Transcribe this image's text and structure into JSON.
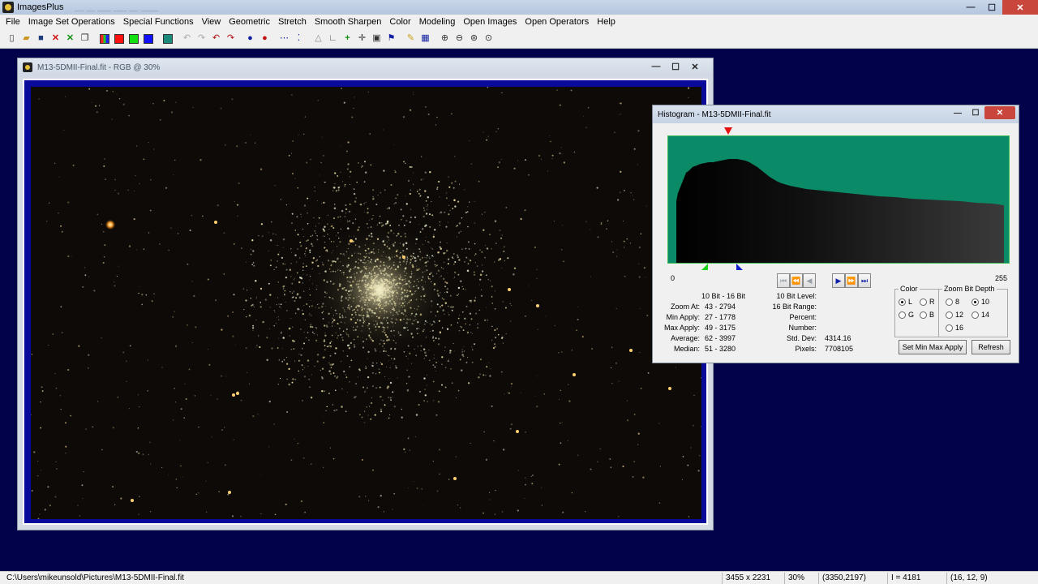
{
  "app": {
    "title": "ImagesPlus",
    "ghost_title": "__ __ ___ ___ __ ____",
    "minimize": "—",
    "maximize": "☐",
    "close": "✕"
  },
  "menu": [
    "File",
    "Image Set Operations",
    "Special Functions",
    "View",
    "Geometric",
    "Stretch",
    "Smooth Sharpen",
    "Color",
    "Modeling",
    "Open Images",
    "Open Operators",
    "Help"
  ],
  "toolbar": {
    "icons": [
      {
        "name": "new-file-icon",
        "glyph": "🗋",
        "color": "#333"
      },
      {
        "name": "open-folder-icon",
        "glyph": "📂",
        "color": "#c8961e"
      },
      {
        "name": "save-icon",
        "glyph": "💾",
        "color": "#1a3a7a"
      },
      {
        "name": "close-red-icon",
        "glyph": "✕",
        "color": "#d01010"
      },
      {
        "name": "close-green-icon",
        "glyph": "✕",
        "color": "#109010"
      },
      {
        "name": "copy-icon",
        "glyph": "⧉",
        "color": "#222"
      }
    ],
    "channel_colors": [
      "#ffffff",
      "#ff1010",
      "#10e010",
      "#1010ff"
    ],
    "colors": {
      "rgb": "#ff1010",
      "red": "#ff1010",
      "green": "#10e010",
      "blue": "#1010ff"
    }
  },
  "image_window": {
    "title": "M13-5DMII-Final.fit - RGB @ 30%",
    "minimize": "—",
    "maximize": "☐",
    "close": "✕"
  },
  "histogram": {
    "title": "Histogram - M13-5DMII-Final.fit",
    "minimize": "—",
    "maximize": "☐",
    "close": "✕",
    "axis_min": "0",
    "axis_max": "255",
    "colors": {
      "plot_bg": "#0b8a68",
      "max_marker": "#e61010",
      "min_marker": "#1bd11b",
      "apply_marker": "#1020c8"
    },
    "left_stats": {
      "header": "10 Bit - 16 Bit",
      "rows": [
        {
          "label": "Zoom At:",
          "value": "43 - 2794"
        },
        {
          "label": "Min Apply:",
          "value": "27 - 1778"
        },
        {
          "label": "Max Apply:",
          "value": "49 - 3175"
        },
        {
          "label": "Average:",
          "value": "62 - 3997"
        },
        {
          "label": "Median:",
          "value": "51 - 3280"
        }
      ]
    },
    "right_stats": {
      "rows": [
        {
          "label": "10 Bit Level:",
          "value": ""
        },
        {
          "label": "16 Bit Range:",
          "value": ""
        },
        {
          "label": "Percent:",
          "value": ""
        },
        {
          "label": "Number:",
          "value": ""
        },
        {
          "label": "Std. Dev:",
          "value": "4314.16"
        },
        {
          "label": "Pixels:",
          "value": "7708105"
        }
      ]
    },
    "color_group": {
      "label": "Color",
      "options": [
        {
          "label": "L",
          "selected": true
        },
        {
          "label": "R",
          "selected": false
        },
        {
          "label": "G",
          "selected": false
        },
        {
          "label": "B",
          "selected": false
        }
      ]
    },
    "bit_depth_group": {
      "label": "Zoom Bit Depth",
      "options": [
        {
          "label": "8",
          "selected": false
        },
        {
          "label": "10",
          "selected": true
        },
        {
          "label": "12",
          "selected": false
        },
        {
          "label": "14",
          "selected": false
        },
        {
          "label": "16",
          "selected": false
        }
      ]
    },
    "buttons": {
      "set_min_max": "Set Min Max Apply",
      "refresh": "Refresh"
    }
  },
  "statusbar": {
    "path": "C:\\Users\\mikeunsold\\Pictures\\M13-5DMII-Final.fit",
    "dimensions": "3455 x 2231",
    "zoom": "30%",
    "coords": "(3350,2197)",
    "intensity": "I = 4181",
    "rgb": "(16, 12, 9)"
  }
}
